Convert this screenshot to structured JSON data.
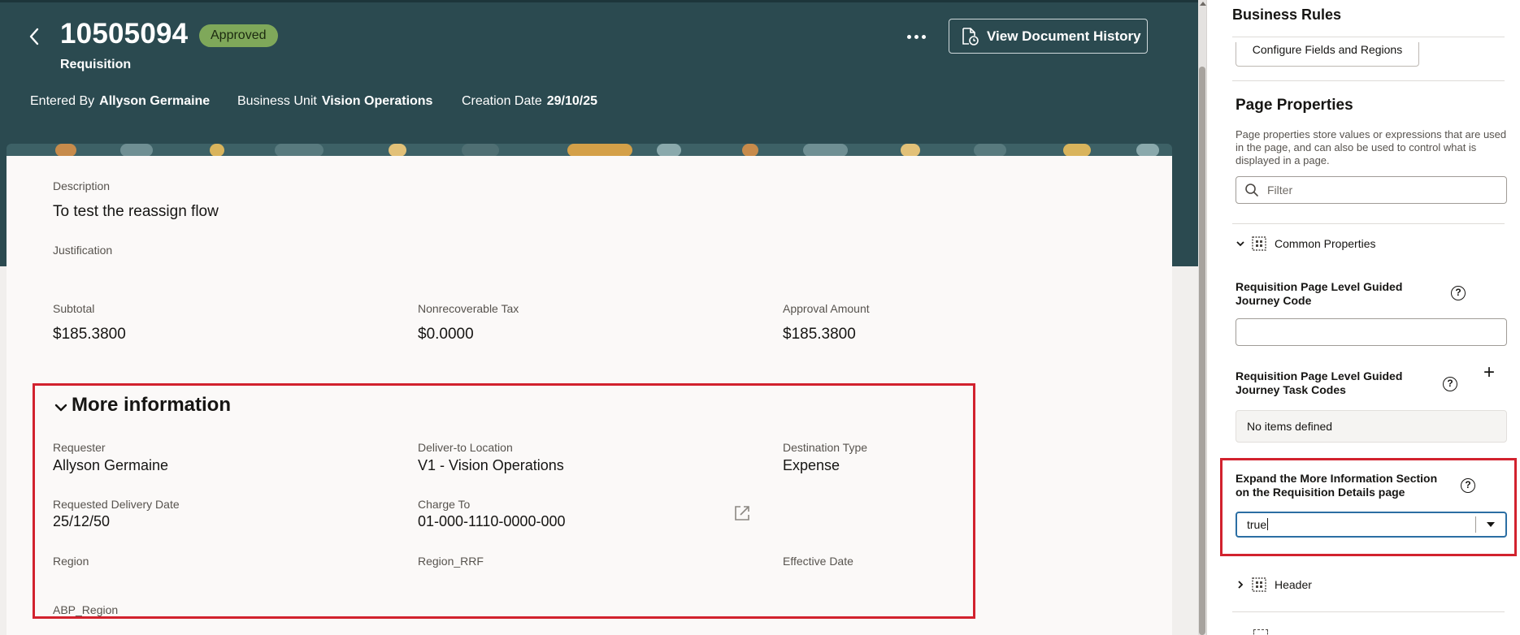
{
  "header": {
    "doc_number": "10505094",
    "status": "Approved",
    "doc_type": "Requisition",
    "history_button": "View Document History",
    "meta": {
      "entered_by_label": "Entered By",
      "entered_by_value": "Allyson Germaine",
      "business_unit_label": "Business Unit",
      "business_unit_value": "Vision Operations",
      "creation_date_label": "Creation Date",
      "creation_date_value": "29/10/25"
    }
  },
  "details": {
    "description_label": "Description",
    "description_value": "To test the reassign flow",
    "justification_label": "Justification",
    "subtotal_label": "Subtotal",
    "subtotal_value": "$185.3800",
    "tax_label": "Nonrecoverable Tax",
    "tax_value": "$0.0000",
    "approval_label": "Approval Amount",
    "approval_value": "$185.3800"
  },
  "more_info": {
    "title": "More information",
    "requester_label": "Requester",
    "requester_value": "Allyson Germaine",
    "deliver_label": "Deliver-to Location",
    "deliver_value": "V1 - Vision Operations",
    "dest_type_label": "Destination Type",
    "dest_type_value": "Expense",
    "req_date_label": "Requested Delivery Date",
    "req_date_value": "25/12/50",
    "charge_to_label": "Charge To",
    "charge_to_value": "01-000-1110-0000-000",
    "region_label": "Region",
    "region_rrf_label": "Region_RRF",
    "effective_date_label": "Effective Date",
    "abp_region_label": "ABP_Region"
  },
  "panel": {
    "title": "Business Rules",
    "configure_button": "Configure Fields and Regions",
    "page_properties_title": "Page Properties",
    "page_properties_desc": "Page properties store values or expressions that are used in the page, and can also be used to control what is displayed in a page.",
    "filter_placeholder": "Filter",
    "common_properties": "Common Properties",
    "journey_code_label": "Requisition Page Level Guided Journey Code",
    "journey_tasks_label": "Requisition Page Level Guided Journey Task Codes",
    "no_items": "No items defined",
    "expand_label": "Expand the More Information Section on the Requisition Details page",
    "expand_value": "true",
    "header_section": "Header"
  },
  "colors": {
    "header_bg": "#2b4a50",
    "status_badge": "#7fa85a",
    "highlight": "#d2222e",
    "focus": "#2b6ea3"
  },
  "icons": [
    "back-chevron-icon",
    "more-dots-icon",
    "document-history-icon",
    "chevron-down-icon",
    "open-link-icon",
    "search-icon",
    "grid-icon",
    "help-icon",
    "plus-icon",
    "chevron-right-icon",
    "dropdown-arrow-icon"
  ]
}
